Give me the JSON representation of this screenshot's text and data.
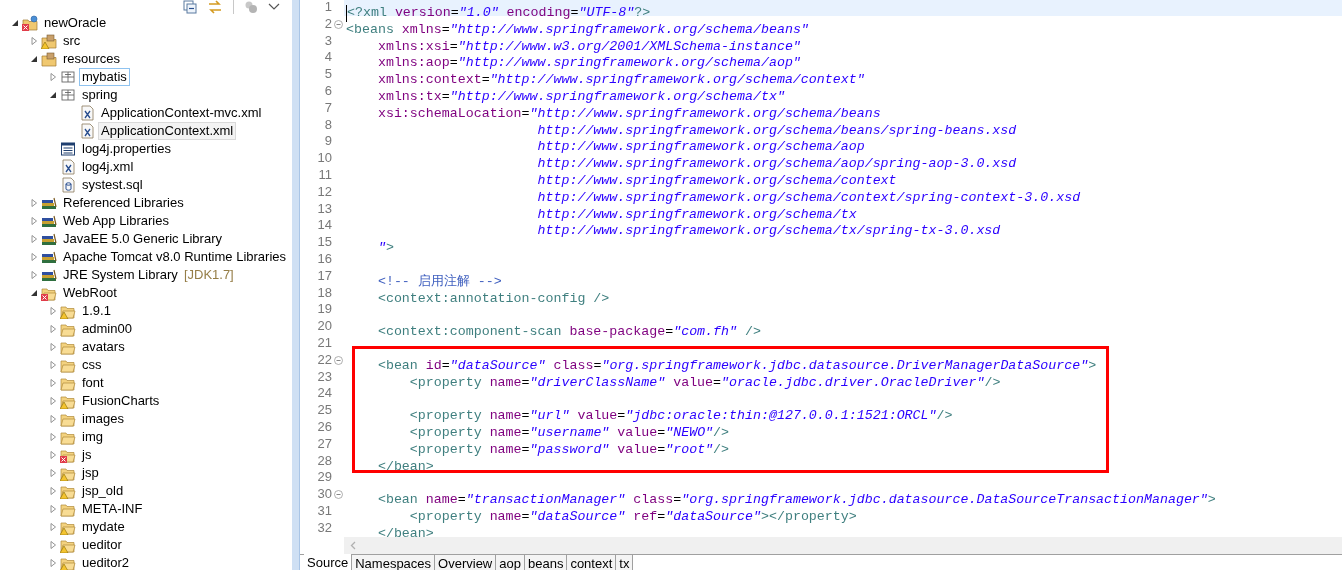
{
  "explorer": {
    "tree": [
      {
        "label": "newOracle",
        "kind": "project",
        "warning": false,
        "error": true,
        "expanded": true,
        "selected": false,
        "focused": false,
        "children": [
          {
            "label": "src",
            "kind": "source-folder",
            "warning": true,
            "error": false,
            "expanded": false,
            "selected": false,
            "focused": false
          },
          {
            "label": "resources",
            "kind": "source-folder",
            "warning": false,
            "error": false,
            "expanded": true,
            "selected": false,
            "focused": false,
            "children": [
              {
                "label": "mybatis",
                "kind": "package",
                "warning": false,
                "error": false,
                "expanded": false,
                "selected": false,
                "focused": true
              },
              {
                "label": "spring",
                "kind": "package",
                "warning": false,
                "error": false,
                "expanded": true,
                "selected": false,
                "focused": false,
                "children": [
                  {
                    "label": "ApplicationContext-mvc.xml",
                    "kind": "xml-file",
                    "warning": false,
                    "error": false,
                    "selected": false,
                    "focused": false
                  },
                  {
                    "label": "ApplicationContext.xml",
                    "kind": "xml-file",
                    "warning": false,
                    "error": false,
                    "selected": true,
                    "focused": false
                  }
                ]
              },
              {
                "label": "log4j.properties",
                "kind": "properties-file",
                "warning": false,
                "error": false,
                "selected": false,
                "focused": false
              },
              {
                "label": "log4j.xml",
                "kind": "xml-file",
                "warning": false,
                "error": false,
                "selected": false,
                "focused": false
              },
              {
                "label": "systest.sql",
                "kind": "sql-file",
                "warning": false,
                "error": false,
                "selected": false,
                "focused": false
              }
            ]
          },
          {
            "label": "Referenced Libraries",
            "kind": "library",
            "warning": false,
            "error": false,
            "expanded": false,
            "selected": false,
            "focused": false
          },
          {
            "label": "Web App Libraries",
            "kind": "library",
            "warning": false,
            "error": false,
            "expanded": false,
            "selected": false,
            "focused": false
          },
          {
            "label": "JavaEE 5.0 Generic Library",
            "kind": "library",
            "warning": false,
            "error": false,
            "expanded": false,
            "selected": false,
            "focused": false
          },
          {
            "label": "Apache Tomcat v8.0 Runtime Libraries",
            "kind": "library",
            "warning": false,
            "error": false,
            "expanded": false,
            "selected": false,
            "focused": false
          },
          {
            "label": "JRE System Library",
            "decoration": "[JDK1.7]",
            "kind": "library",
            "warning": false,
            "error": false,
            "expanded": false,
            "selected": false,
            "focused": false
          },
          {
            "label": "WebRoot",
            "kind": "folder",
            "warning": false,
            "error": true,
            "expanded": true,
            "selected": false,
            "focused": false,
            "children": [
              {
                "label": "1.9.1",
                "kind": "folder",
                "warning": true,
                "error": false,
                "expanded": false,
                "selected": false,
                "focused": false
              },
              {
                "label": "admin00",
                "kind": "folder",
                "warning": false,
                "error": false,
                "expanded": false,
                "selected": false,
                "focused": false
              },
              {
                "label": "avatars",
                "kind": "folder",
                "warning": false,
                "error": false,
                "expanded": false,
                "selected": false,
                "focused": false
              },
              {
                "label": "css",
                "kind": "folder",
                "warning": false,
                "error": false,
                "expanded": false,
                "selected": false,
                "focused": false
              },
              {
                "label": "font",
                "kind": "folder",
                "warning": false,
                "error": false,
                "expanded": false,
                "selected": false,
                "focused": false
              },
              {
                "label": "FusionCharts",
                "kind": "folder",
                "warning": true,
                "error": false,
                "expanded": false,
                "selected": false,
                "focused": false
              },
              {
                "label": "images",
                "kind": "folder",
                "warning": false,
                "error": false,
                "expanded": false,
                "selected": false,
                "focused": false
              },
              {
                "label": "img",
                "kind": "folder",
                "warning": false,
                "error": false,
                "expanded": false,
                "selected": false,
                "focused": false
              },
              {
                "label": "js",
                "kind": "folder",
                "warning": false,
                "error": true,
                "expanded": false,
                "selected": false,
                "focused": false
              },
              {
                "label": "jsp",
                "kind": "folder",
                "warning": true,
                "error": false,
                "expanded": false,
                "selected": false,
                "focused": false
              },
              {
                "label": "jsp_old",
                "kind": "folder",
                "warning": true,
                "error": false,
                "expanded": false,
                "selected": false,
                "focused": false
              },
              {
                "label": "META-INF",
                "kind": "folder",
                "warning": false,
                "error": false,
                "expanded": false,
                "selected": false,
                "focused": false
              },
              {
                "label": "mydate",
                "kind": "folder",
                "warning": true,
                "error": false,
                "expanded": false,
                "selected": false,
                "focused": false
              },
              {
                "label": "ueditor",
                "kind": "folder",
                "warning": true,
                "error": false,
                "expanded": false,
                "selected": false,
                "focused": false
              },
              {
                "label": "ueditor2",
                "kind": "folder",
                "warning": true,
                "error": false,
                "expanded": false,
                "selected": false,
                "focused": false
              }
            ]
          }
        ]
      }
    ]
  },
  "editor": {
    "lines": [
      {
        "number": "1",
        "current": true,
        "foldable": false,
        "boxed": false,
        "tokens": [
          {
            "kind": "tag",
            "text": "<?xml"
          },
          {
            "kind": "attr",
            "text": " version"
          },
          {
            "kind": "plain",
            "text": "="
          },
          {
            "kind": "string",
            "text": "\"1.0\""
          },
          {
            "kind": "attr",
            "text": " encoding"
          },
          {
            "kind": "plain",
            "text": "="
          },
          {
            "kind": "string",
            "text": "\"UTF-8\""
          },
          {
            "kind": "tag",
            "text": "?>"
          }
        ]
      },
      {
        "number": "2",
        "current": false,
        "foldable": true,
        "boxed": false,
        "tokens": [
          {
            "kind": "tag",
            "text": "<beans"
          },
          {
            "kind": "attr",
            "text": " xmlns"
          },
          {
            "kind": "plain",
            "text": "="
          },
          {
            "kind": "string",
            "text": "\"http://www.springframework.org/schema/beans\""
          }
        ]
      },
      {
        "number": "3",
        "current": false,
        "foldable": false,
        "boxed": false,
        "tokens": [
          {
            "kind": "attr",
            "text": "    xmlns:xsi"
          },
          {
            "kind": "plain",
            "text": "="
          },
          {
            "kind": "string",
            "text": "\"http://www.w3.org/2001/XMLSchema-instance\""
          }
        ]
      },
      {
        "number": "4",
        "current": false,
        "foldable": false,
        "boxed": false,
        "tokens": [
          {
            "kind": "attr",
            "text": "    xmlns:aop"
          },
          {
            "kind": "plain",
            "text": "="
          },
          {
            "kind": "string",
            "text": "\"http://www.springframework.org/schema/aop\""
          }
        ]
      },
      {
        "number": "5",
        "current": false,
        "foldable": false,
        "boxed": false,
        "tokens": [
          {
            "kind": "attr",
            "text": "    xmlns:context"
          },
          {
            "kind": "plain",
            "text": "="
          },
          {
            "kind": "string",
            "text": "\"http://www.springframework.org/schema/context\""
          }
        ]
      },
      {
        "number": "6",
        "current": false,
        "foldable": false,
        "boxed": false,
        "tokens": [
          {
            "kind": "attr",
            "text": "    xmlns:tx"
          },
          {
            "kind": "plain",
            "text": "="
          },
          {
            "kind": "string",
            "text": "\"http://www.springframework.org/schema/tx\""
          }
        ]
      },
      {
        "number": "7",
        "current": false,
        "foldable": false,
        "boxed": false,
        "tokens": [
          {
            "kind": "attr",
            "text": "    xsi:schemaLocation"
          },
          {
            "kind": "plain",
            "text": "="
          },
          {
            "kind": "string",
            "text": "\"http://www.springframework.org/schema/beans"
          }
        ]
      },
      {
        "number": "8",
        "current": false,
        "foldable": false,
        "boxed": false,
        "tokens": [
          {
            "kind": "string",
            "text": "                        http://www.springframework.org/schema/beans/spring-beans.xsd"
          }
        ]
      },
      {
        "number": "9",
        "current": false,
        "foldable": false,
        "boxed": false,
        "tokens": [
          {
            "kind": "string",
            "text": "                        http://www.springframework.org/schema/aop"
          }
        ]
      },
      {
        "number": "10",
        "current": false,
        "foldable": false,
        "boxed": false,
        "tokens": [
          {
            "kind": "string",
            "text": "                        http://www.springframework.org/schema/aop/spring-aop-3.0.xsd"
          }
        ]
      },
      {
        "number": "11",
        "current": false,
        "foldable": false,
        "boxed": false,
        "tokens": [
          {
            "kind": "string",
            "text": "                        http://www.springframework.org/schema/context"
          }
        ]
      },
      {
        "number": "12",
        "current": false,
        "foldable": false,
        "boxed": false,
        "tokens": [
          {
            "kind": "string",
            "text": "                        http://www.springframework.org/schema/context/spring-context-3.0.xsd"
          }
        ]
      },
      {
        "number": "13",
        "current": false,
        "foldable": false,
        "boxed": false,
        "tokens": [
          {
            "kind": "string",
            "text": "                        http://www.springframework.org/schema/tx"
          }
        ]
      },
      {
        "number": "14",
        "current": false,
        "foldable": false,
        "boxed": false,
        "tokens": [
          {
            "kind": "string",
            "text": "                        http://www.springframework.org/schema/tx/spring-tx-3.0.xsd"
          }
        ]
      },
      {
        "number": "15",
        "current": false,
        "foldable": false,
        "boxed": false,
        "tokens": [
          {
            "kind": "string",
            "text": "    \""
          },
          {
            "kind": "tag",
            "text": ">"
          }
        ]
      },
      {
        "number": "16",
        "current": false,
        "foldable": false,
        "boxed": false
      },
      {
        "number": "17",
        "current": false,
        "foldable": false,
        "boxed": false,
        "tokens": [
          {
            "kind": "comment",
            "text": "    <!-- 启用注解 -->"
          }
        ]
      },
      {
        "number": "18",
        "current": false,
        "foldable": false,
        "boxed": false,
        "tokens": [
          {
            "kind": "tag",
            "text": "    <context:annotation-config />"
          }
        ]
      },
      {
        "number": "19",
        "current": false,
        "foldable": false,
        "boxed": false
      },
      {
        "number": "20",
        "current": false,
        "foldable": false,
        "boxed": false,
        "tokens": [
          {
            "kind": "tag",
            "text": "    <context:component-scan"
          },
          {
            "kind": "attr",
            "text": " base-package"
          },
          {
            "kind": "plain",
            "text": "="
          },
          {
            "kind": "string",
            "text": "\"com.fh\""
          },
          {
            "kind": "tag",
            "text": " />"
          }
        ]
      },
      {
        "number": "21",
        "current": false,
        "foldable": false,
        "boxed": false
      },
      {
        "number": "22",
        "current": false,
        "foldable": true,
        "boxed": true,
        "tokens": [
          {
            "kind": "tag",
            "text": "    <bean"
          },
          {
            "kind": "attr",
            "text": " id"
          },
          {
            "kind": "plain",
            "text": "="
          },
          {
            "kind": "string",
            "text": "\"dataSource\""
          },
          {
            "kind": "attr",
            "text": " class"
          },
          {
            "kind": "plain",
            "text": "="
          },
          {
            "kind": "string",
            "text": "\"org.springframework.jdbc.datasource.DriverManagerDataSource\""
          },
          {
            "kind": "tag",
            "text": ">"
          }
        ]
      },
      {
        "number": "23",
        "current": false,
        "foldable": false,
        "boxed": true,
        "tokens": [
          {
            "kind": "tag",
            "text": "        <property"
          },
          {
            "kind": "attr",
            "text": " name"
          },
          {
            "kind": "plain",
            "text": "="
          },
          {
            "kind": "string",
            "text": "\"driverClassName\""
          },
          {
            "kind": "attr",
            "text": " value"
          },
          {
            "kind": "plain",
            "text": "="
          },
          {
            "kind": "string",
            "text": "\"oracle.jdbc.driver.OracleDriver\""
          },
          {
            "kind": "tag",
            "text": "/>"
          }
        ]
      },
      {
        "number": "24",
        "current": false,
        "foldable": false,
        "boxed": true
      },
      {
        "number": "25",
        "current": false,
        "foldable": false,
        "boxed": true,
        "tokens": [
          {
            "kind": "tag",
            "text": "        <property"
          },
          {
            "kind": "attr",
            "text": " name"
          },
          {
            "kind": "plain",
            "text": "="
          },
          {
            "kind": "string",
            "text": "\"url\""
          },
          {
            "kind": "attr",
            "text": " value"
          },
          {
            "kind": "plain",
            "text": "="
          },
          {
            "kind": "string",
            "text": "\"jdbc:oracle:thin:@127.0.0.1:1521:ORCL\""
          },
          {
            "kind": "tag",
            "text": "/>"
          }
        ]
      },
      {
        "number": "26",
        "current": false,
        "foldable": false,
        "boxed": true,
        "tokens": [
          {
            "kind": "tag",
            "text": "        <property"
          },
          {
            "kind": "attr",
            "text": " name"
          },
          {
            "kind": "plain",
            "text": "="
          },
          {
            "kind": "string",
            "text": "\"username\""
          },
          {
            "kind": "attr",
            "text": " value"
          },
          {
            "kind": "plain",
            "text": "="
          },
          {
            "kind": "string",
            "text": "\"NEWO\""
          },
          {
            "kind": "tag",
            "text": "/>"
          }
        ]
      },
      {
        "number": "27",
        "current": false,
        "foldable": false,
        "boxed": true,
        "tokens": [
          {
            "kind": "tag",
            "text": "        <property"
          },
          {
            "kind": "attr",
            "text": " name"
          },
          {
            "kind": "plain",
            "text": "="
          },
          {
            "kind": "string",
            "text": "\"password\""
          },
          {
            "kind": "attr",
            "text": " value"
          },
          {
            "kind": "plain",
            "text": "="
          },
          {
            "kind": "string",
            "text": "\"root\""
          },
          {
            "kind": "tag",
            "text": "/>"
          }
        ]
      },
      {
        "number": "28",
        "current": false,
        "foldable": false,
        "boxed": true,
        "tokens": [
          {
            "kind": "tag",
            "text": "    </bean>"
          }
        ]
      },
      {
        "number": "29",
        "current": false,
        "foldable": false,
        "boxed": false
      },
      {
        "number": "30",
        "current": false,
        "foldable": true,
        "boxed": false,
        "tokens": [
          {
            "kind": "tag",
            "text": "    <bean"
          },
          {
            "kind": "attr",
            "text": " name"
          },
          {
            "kind": "plain",
            "text": "="
          },
          {
            "kind": "string",
            "text": "\"transactionManager\""
          },
          {
            "kind": "attr",
            "text": " class"
          },
          {
            "kind": "plain",
            "text": "="
          },
          {
            "kind": "string",
            "text": "\"org.springframework.jdbc.datasource.DataSourceTransactionManager\""
          },
          {
            "kind": "tag",
            "text": ">"
          }
        ]
      },
      {
        "number": "31",
        "current": false,
        "foldable": false,
        "boxed": false,
        "tokens": [
          {
            "kind": "tag",
            "text": "        <property"
          },
          {
            "kind": "attr",
            "text": " name"
          },
          {
            "kind": "plain",
            "text": "="
          },
          {
            "kind": "string",
            "text": "\"dataSource\""
          },
          {
            "kind": "attr",
            "text": " ref"
          },
          {
            "kind": "plain",
            "text": "="
          },
          {
            "kind": "string",
            "text": "\"dataSource\""
          },
          {
            "kind": "tag",
            "text": "></property>"
          }
        ]
      },
      {
        "number": "32",
        "current": false,
        "foldable": false,
        "boxed": false,
        "tokens": [
          {
            "kind": "tag",
            "text": "    </bean>"
          }
        ]
      }
    ],
    "tabs": [
      {
        "label": "Source",
        "selected": true
      },
      {
        "label": "Namespaces",
        "selected": false
      },
      {
        "label": "Overview",
        "selected": false
      },
      {
        "label": "aop",
        "selected": false
      },
      {
        "label": "beans",
        "selected": false
      },
      {
        "label": "context",
        "selected": false
      },
      {
        "label": "tx",
        "selected": false
      }
    ]
  }
}
